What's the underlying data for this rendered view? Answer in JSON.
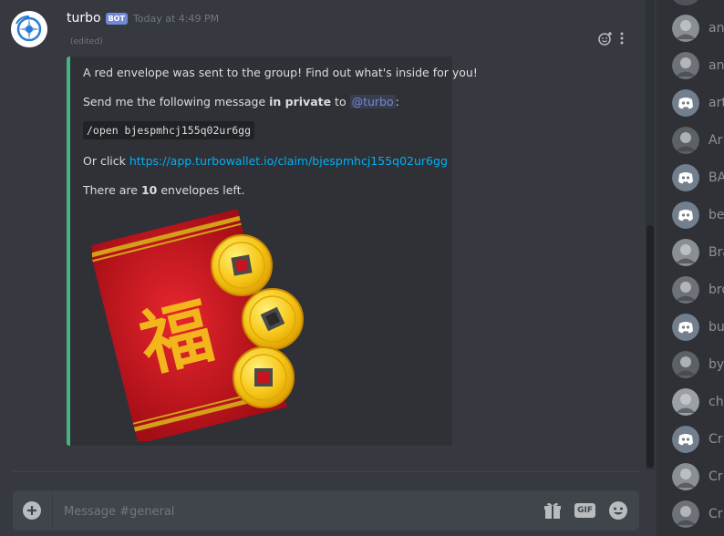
{
  "message": {
    "author": "turbo",
    "bot_tag": "BOT",
    "timestamp": "Today at 4:49 PM",
    "edited": "(edited)"
  },
  "embed": {
    "line1": "A red envelope was sent to the group! Find out what's inside for you!",
    "line2_prefix": "Send me the following message ",
    "line2_bold": "in private",
    "line2_mid": " to ",
    "line2_mention": "@turbo",
    "line2_suffix": ":",
    "command": "/open bjespmhcj155q02ur6gg",
    "line4_prefix": "Or click ",
    "link": "https://app.turbowallet.io/claim/bjespmhcj155q02ur6gg",
    "line5_prefix": "There are ",
    "line5_bold": "10",
    "line5_suffix": " envelopes left.",
    "image_character": "福",
    "accent_color": "#43b581"
  },
  "composer": {
    "placeholder": "Message #general",
    "gif_label": "GIF"
  },
  "members": [
    {
      "name": "an",
      "avatar": "photo-avatar"
    },
    {
      "name": "an",
      "avatar": "photo-avatar"
    },
    {
      "name": "art",
      "avatar": "discord-default-avatar"
    },
    {
      "name": "Ar",
      "avatar": "photo-avatar"
    },
    {
      "name": "BA",
      "avatar": "discord-default-avatar"
    },
    {
      "name": "be",
      "avatar": "discord-default-avatar"
    },
    {
      "name": "Bra",
      "avatar": "photo-avatar"
    },
    {
      "name": "bro",
      "avatar": "photo-avatar"
    },
    {
      "name": "bu",
      "avatar": "discord-default-avatar"
    },
    {
      "name": "by",
      "avatar": "photo-avatar"
    },
    {
      "name": "che",
      "avatar": "photo-avatar"
    },
    {
      "name": "Cr",
      "avatar": "discord-default-avatar"
    },
    {
      "name": "Cr",
      "avatar": "photo-avatar"
    },
    {
      "name": "Cr",
      "avatar": "photo-avatar"
    }
  ],
  "colors": {
    "background": "#36393f",
    "sidebar": "#2f3136",
    "mention": "#7289da",
    "link": "#00b0f4",
    "envelope_red": "#c8141e",
    "coin_gold": "#f5c518"
  }
}
